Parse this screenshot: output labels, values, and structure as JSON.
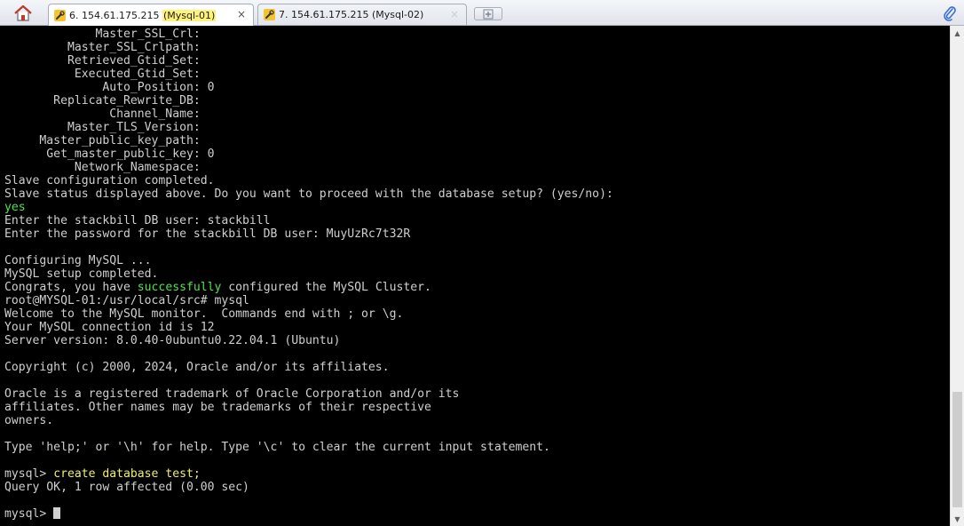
{
  "tabs": [
    {
      "number": "6.",
      "host": "154.61.175.215",
      "label_open": "(",
      "label": "Mysql-01",
      "label_close": ")",
      "close": "×",
      "active": true
    },
    {
      "number": "7.",
      "host": "154.61.175.215",
      "label_open": "(",
      "label": "Mysql-02",
      "label_close": ")",
      "close": "×",
      "active": false
    }
  ],
  "icons": {
    "home": "home-icon",
    "tab_session": "wrench-icon",
    "new_tab": "plus-icon",
    "attach": "paperclip-icon"
  },
  "colors": {
    "terminal_bg": "#000000",
    "terminal_fg": "#cfcfcf",
    "highlight_green": "#4ee44e",
    "highlight_yellow": "#f2f06a",
    "tab_highlight": "#fff27a"
  },
  "terminal": {
    "lines": [
      "             Master_SSL_Crl:",
      "         Master_SSL_Crlpath:",
      "         Retrieved_Gtid_Set:",
      "          Executed_Gtid_Set:",
      "              Auto_Position: 0",
      "       Replicate_Rewrite_DB:",
      "               Channel_Name:",
      "         Master_TLS_Version:",
      "     Master_public_key_path:",
      "      Get_master_public_key: 0",
      "          Network_Namespace:",
      "Slave configuration completed.",
      "Slave status displayed above. Do you want to proceed with the database setup? (yes/no):",
      "yes",
      "Enter the stackbill DB user: stackbill",
      "Enter the password for the stackbill DB user: MuyUzRc7t32R",
      "",
      "Configuring MySQL ...",
      "MySQL setup completed.",
      "Congrats, you have ",
      "successfully",
      " configured the MySQL Cluster.",
      "root@MYSQL-01:/usr/local/src# mysql",
      "Welcome to the MySQL monitor.  Commands end with ; or \\g.",
      "Your MySQL connection id is 12",
      "Server version: 8.0.40-0ubuntu0.22.04.1 (Ubuntu)",
      "",
      "Copyright (c) 2000, 2024, Oracle and/or its affiliates.",
      "",
      "Oracle is a registered trademark of Oracle Corporation and/or its",
      "affiliates. Other names may be trademarks of their respective",
      "owners.",
      "",
      "Type 'help;' or '\\h' for help. Type '\\c' to clear the current input statement.",
      "",
      "mysql> ",
      "create database test;",
      "Query OK, 1 row affected (0.00 sec)",
      "",
      "mysql> "
    ]
  },
  "scrollbar": {
    "up": "▲",
    "down": "▼"
  }
}
